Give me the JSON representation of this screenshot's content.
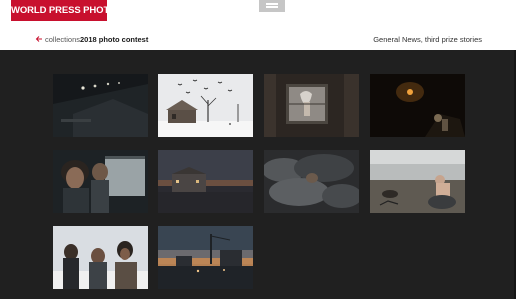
{
  "header": {
    "logo_text": "WORLD PRESS PHOTO",
    "brand_color": "#c8102e",
    "menu_icon": "hamburger-icon"
  },
  "breadcrumb": {
    "back_icon": "arrow-left-icon",
    "link_label": "collections",
    "current_label": "2018 photo contest"
  },
  "category_label": "General News, third prize stories",
  "gallery": {
    "background": "#202020",
    "photos": [
      {
        "subject": "dark warehouse interior with lights"
      },
      {
        "subject": "snowy field with house and crows"
      },
      {
        "subject": "window in wooden wall"
      },
      {
        "subject": "dark interior with fire glow"
      },
      {
        "subject": "young men by train window"
      },
      {
        "subject": "building at dusk"
      },
      {
        "subject": "people sleeping under blankets"
      },
      {
        "subject": "man washing in snow"
      },
      {
        "subject": "group of men in winter"
      },
      {
        "subject": "industrial skyline at sunset"
      }
    ]
  }
}
